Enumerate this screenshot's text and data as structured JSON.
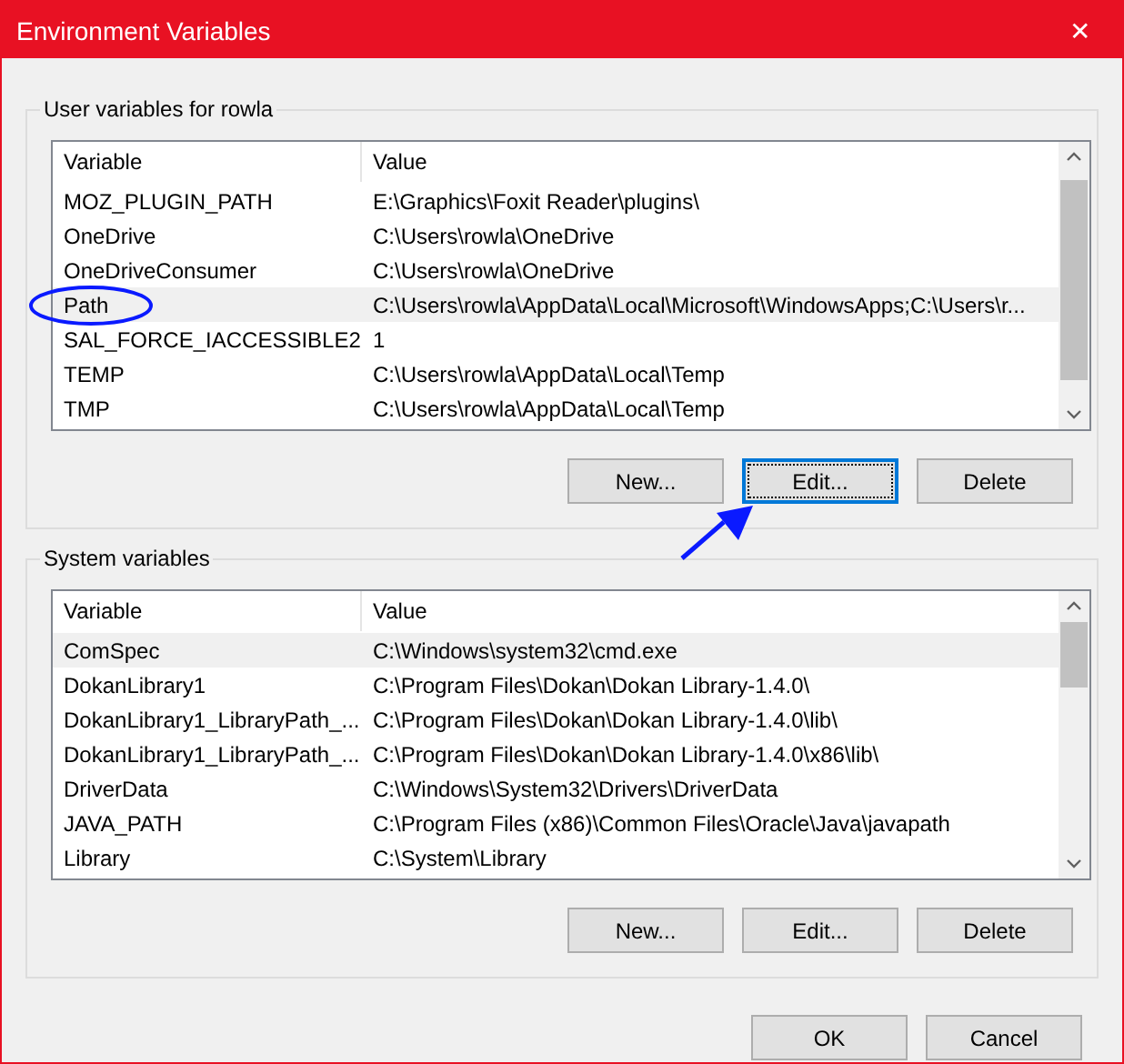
{
  "window": {
    "title": "Environment Variables",
    "close": "✕"
  },
  "groups": [
    {
      "title": "User variables for rowla",
      "columns": [
        "Variable",
        "Value"
      ],
      "rows": [
        {
          "variable": "MOZ_PLUGIN_PATH",
          "value": "E:\\Graphics\\Foxit Reader\\plugins\\",
          "selected": false
        },
        {
          "variable": "OneDrive",
          "value": "C:\\Users\\rowla\\OneDrive",
          "selected": false
        },
        {
          "variable": "OneDriveConsumer",
          "value": "C:\\Users\\rowla\\OneDrive",
          "selected": false
        },
        {
          "variable": "Path",
          "value": "C:\\Users\\rowla\\AppData\\Local\\Microsoft\\WindowsApps;C:\\Users\\r...",
          "selected": true
        },
        {
          "variable": "SAL_FORCE_IACCESSIBLE2",
          "value": "1",
          "selected": false
        },
        {
          "variable": "TEMP",
          "value": "C:\\Users\\rowla\\AppData\\Local\\Temp",
          "selected": false
        },
        {
          "variable": "TMP",
          "value": "C:\\Users\\rowla\\AppData\\Local\\Temp",
          "selected": false
        }
      ],
      "buttons": [
        {
          "label": "New...",
          "focused": false
        },
        {
          "label": "Edit...",
          "focused": true
        },
        {
          "label": "Delete",
          "focused": false
        }
      ]
    },
    {
      "title": "System variables",
      "columns": [
        "Variable",
        "Value"
      ],
      "rows": [
        {
          "variable": "ComSpec",
          "value": "C:\\Windows\\system32\\cmd.exe",
          "selected": true
        },
        {
          "variable": "DokanLibrary1",
          "value": "C:\\Program Files\\Dokan\\Dokan Library-1.4.0\\",
          "selected": false
        },
        {
          "variable": "DokanLibrary1_LibraryPath_...",
          "value": "C:\\Program Files\\Dokan\\Dokan Library-1.4.0\\lib\\",
          "selected": false
        },
        {
          "variable": "DokanLibrary1_LibraryPath_...",
          "value": "C:\\Program Files\\Dokan\\Dokan Library-1.4.0\\x86\\lib\\",
          "selected": false
        },
        {
          "variable": "DriverData",
          "value": "C:\\Windows\\System32\\Drivers\\DriverData",
          "selected": false
        },
        {
          "variable": "JAVA_PATH",
          "value": "C:\\Program Files (x86)\\Common Files\\Oracle\\Java\\javapath",
          "selected": false
        },
        {
          "variable": "Library",
          "value": "C:\\System\\Library",
          "selected": false
        }
      ],
      "buttons": [
        {
          "label": "New...",
          "focused": false
        },
        {
          "label": "Edit...",
          "focused": false
        },
        {
          "label": "Delete",
          "focused": false
        }
      ]
    }
  ],
  "dialog_buttons": [
    "OK",
    "Cancel"
  ]
}
